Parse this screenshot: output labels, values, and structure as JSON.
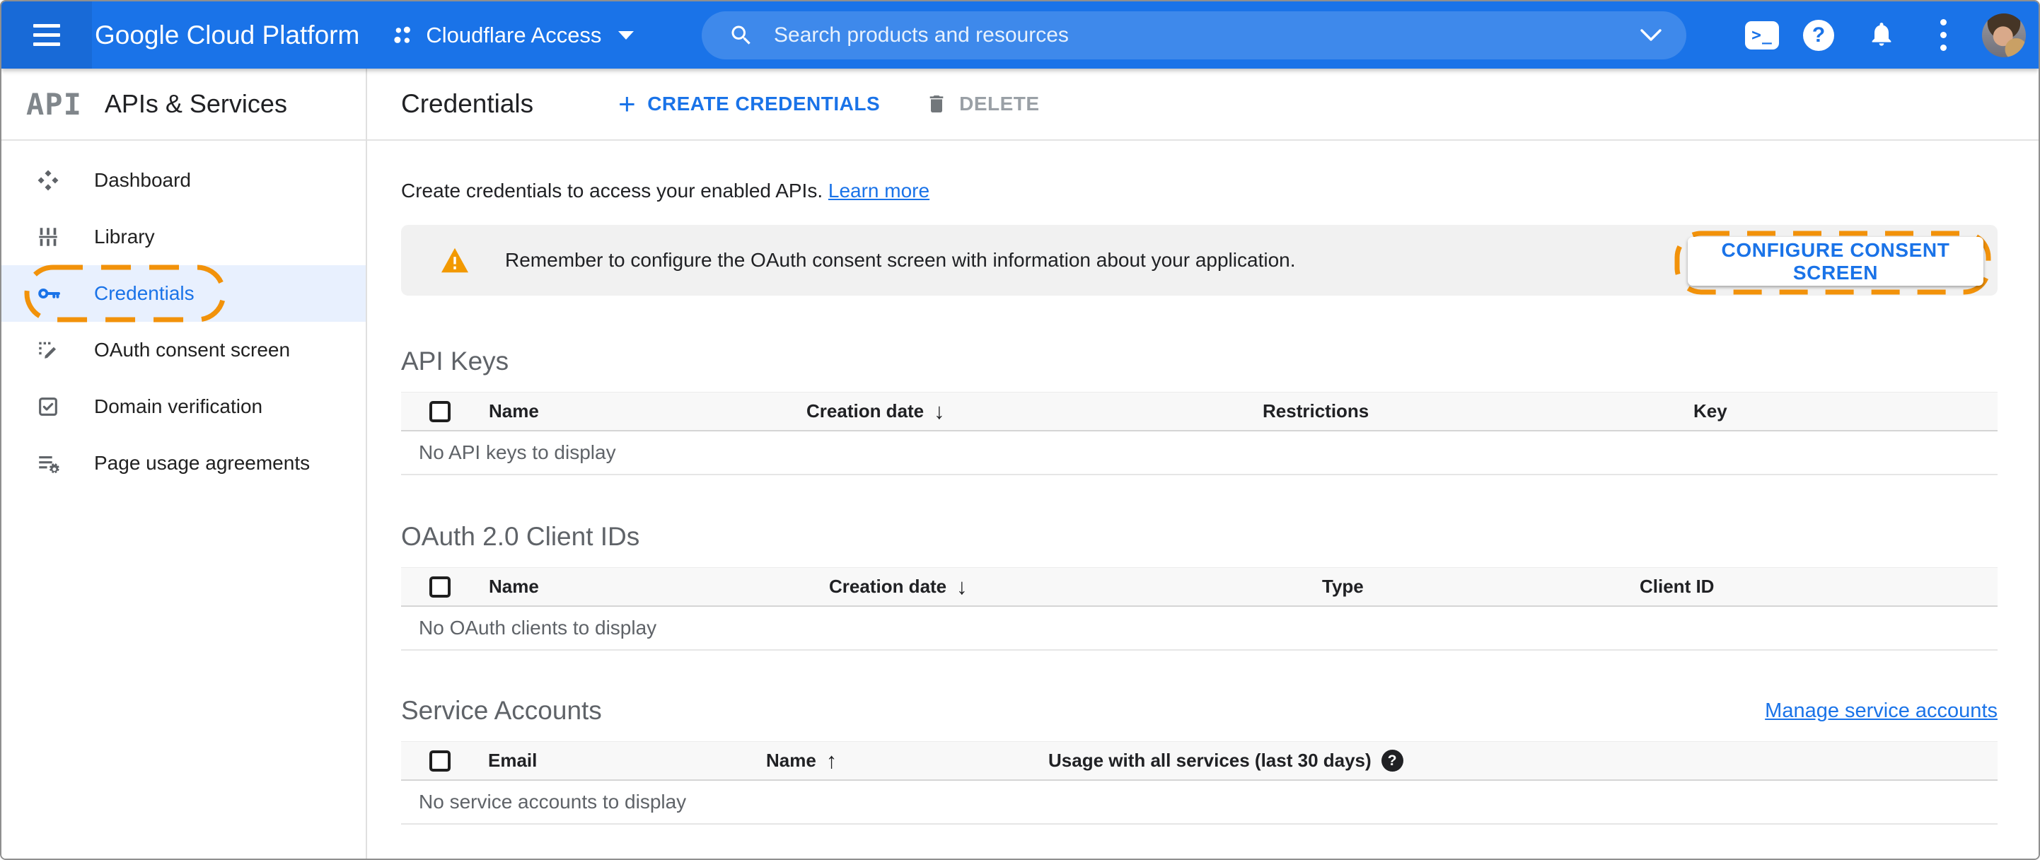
{
  "colors": {
    "accent_blue": "#1a73e8",
    "appbar_blue": "#1a73e8",
    "active_item_bg": "#e8f0fe",
    "highlight_orange": "#f2920a",
    "banner_bg": "#f1f1f1",
    "table_header_bg": "#f8f8f8"
  },
  "topbar": {
    "product_name": "Google Cloud Platform",
    "project_name": "Cloudflare Access",
    "search_placeholder": "Search products and resources"
  },
  "glyphs": {
    "shell_prompt": ">_",
    "help": "?",
    "plus": "+",
    "table_help": "?"
  },
  "sidebar": {
    "logo_text": "API",
    "title": "APIs & Services",
    "items": [
      {
        "label": "Dashboard"
      },
      {
        "label": "Library"
      },
      {
        "label": "Credentials"
      },
      {
        "label": "OAuth consent screen"
      },
      {
        "label": "Domain verification"
      },
      {
        "label": "Page usage agreements"
      }
    ]
  },
  "header": {
    "title": "Credentials",
    "create_button": "CREATE CREDENTIALS",
    "delete_button": "DELETE"
  },
  "intro": {
    "description": "Create credentials to access your enabled APIs.",
    "learn_more_link": "Learn more"
  },
  "banner": {
    "message": "Remember to configure the OAuth consent screen with information about your application.",
    "button": "CONFIGURE CONSENT SCREEN"
  },
  "sections": {
    "api_keys": {
      "title": "API Keys",
      "columns": [
        "Name",
        "Creation date",
        "Restrictions",
        "Key"
      ],
      "sort_arrow": "↓",
      "empty_text": "No API keys to display"
    },
    "oauth_clients": {
      "title": "OAuth 2.0 Client IDs",
      "columns": [
        "Name",
        "Creation date",
        "Type",
        "Client ID"
      ],
      "sort_arrow": "↓",
      "empty_text": "No OAuth clients to display"
    },
    "service_accounts": {
      "title": "Service Accounts",
      "link": "Manage service accounts",
      "columns": [
        "Email",
        "Name",
        "Usage with all services (last 30 days)"
      ],
      "sort_arrow": "↑",
      "empty_text": "No service accounts to display"
    }
  }
}
